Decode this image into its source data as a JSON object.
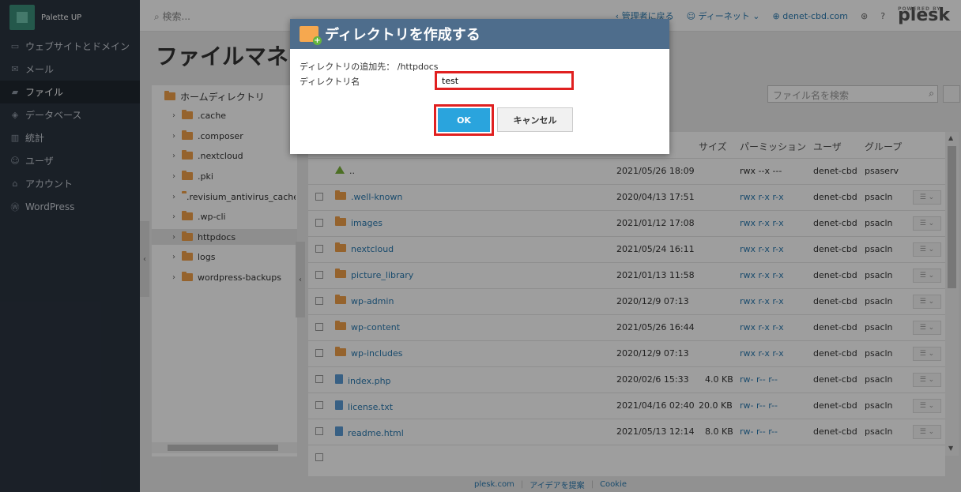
{
  "sidebar": {
    "brand": "Palette UP",
    "items": [
      {
        "label": "ウェブサイトとドメイン",
        "icon": "monitor-icon"
      },
      {
        "label": "メール",
        "icon": "mail-icon"
      },
      {
        "label": "ファイル",
        "icon": "folder-icon"
      },
      {
        "label": "データベース",
        "icon": "database-icon"
      },
      {
        "label": "統計",
        "icon": "chart-icon"
      },
      {
        "label": "ユーザ",
        "icon": "user-icon"
      },
      {
        "label": "アカウント",
        "icon": "account-icon"
      },
      {
        "label": "WordPress",
        "icon": "wordpress-icon"
      }
    ]
  },
  "topbar": {
    "search_placeholder": "検索...",
    "back_admin": "管理者に戻る",
    "user": "ディーネット",
    "domain": "denet-cbd.com",
    "powered_by": "POWERED BY",
    "plesk": "plesk"
  },
  "main": {
    "page_title": "ファイルマネー",
    "file_search_placeholder": "ファイル名を検索"
  },
  "tree": {
    "home": "ホームディレクトリ",
    "items": [
      ".cache",
      ".composer",
      ".nextcloud",
      ".pki",
      ".revisium_antivirus_cache",
      ".wp-cli",
      "httpdocs",
      "logs",
      "wordpress-backups"
    ]
  },
  "table": {
    "headers": {
      "size": "サイズ",
      "perm": "パーミッション",
      "user": "ユーザ",
      "group": "グループ"
    },
    "rows": [
      {
        "name": "..",
        "date": "2021/05/26 18:09",
        "size": "",
        "perm": "rwx --x ---",
        "user": "denet-cbd",
        "group": "psaserv"
      },
      {
        "name": ".well-known",
        "date": "2020/04/13 17:51",
        "size": "",
        "perm": "rwx r-x r-x",
        "user": "denet-cbd",
        "group": "psacln"
      },
      {
        "name": "images",
        "date": "2021/01/12 17:08",
        "size": "",
        "perm": "rwx r-x r-x",
        "user": "denet-cbd",
        "group": "psacln"
      },
      {
        "name": "nextcloud",
        "date": "2021/05/24 16:11",
        "size": "",
        "perm": "rwx r-x r-x",
        "user": "denet-cbd",
        "group": "psacln"
      },
      {
        "name": "picture_library",
        "date": "2021/01/13 11:58",
        "size": "",
        "perm": "rwx r-x r-x",
        "user": "denet-cbd",
        "group": "psacln"
      },
      {
        "name": "wp-admin",
        "date": "2020/12/9 07:13",
        "size": "",
        "perm": "rwx r-x r-x",
        "user": "denet-cbd",
        "group": "psacln"
      },
      {
        "name": "wp-content",
        "date": "2021/05/26 16:44",
        "size": "",
        "perm": "rwx r-x r-x",
        "user": "denet-cbd",
        "group": "psacln"
      },
      {
        "name": "wp-includes",
        "date": "2020/12/9 07:13",
        "size": "",
        "perm": "rwx r-x r-x",
        "user": "denet-cbd",
        "group": "psacln"
      },
      {
        "name": "index.php",
        "date": "2020/02/6 15:33",
        "size": "4.0 KB",
        "perm": "rw- r-- r--",
        "user": "denet-cbd",
        "group": "psacln"
      },
      {
        "name": "license.txt",
        "date": "2021/04/16 02:40",
        "size": "20.0 KB",
        "perm": "rw- r-- r--",
        "user": "denet-cbd",
        "group": "psacln"
      },
      {
        "name": "readme.html",
        "date": "2021/05/13 12:14",
        "size": "8.0 KB",
        "perm": "rw- r-- r--",
        "user": "denet-cbd",
        "group": "psacln"
      }
    ]
  },
  "footer": {
    "links": [
      "plesk.com",
      "アイデアを提案",
      "Cookie"
    ]
  },
  "dialog": {
    "title": "ディレクトリを作成する",
    "dest_label": "ディレクトリの追加先：",
    "dest_path": "/httpdocs",
    "name_label": "ディレクトリ名",
    "name_value": "test",
    "ok": "OK",
    "cancel": "キャンセル"
  },
  "colors": {
    "sidebar": "#2b3440",
    "dialog_header": "#4e6d8c",
    "ok_button": "#2aa4dd",
    "highlight": "#e02020"
  }
}
